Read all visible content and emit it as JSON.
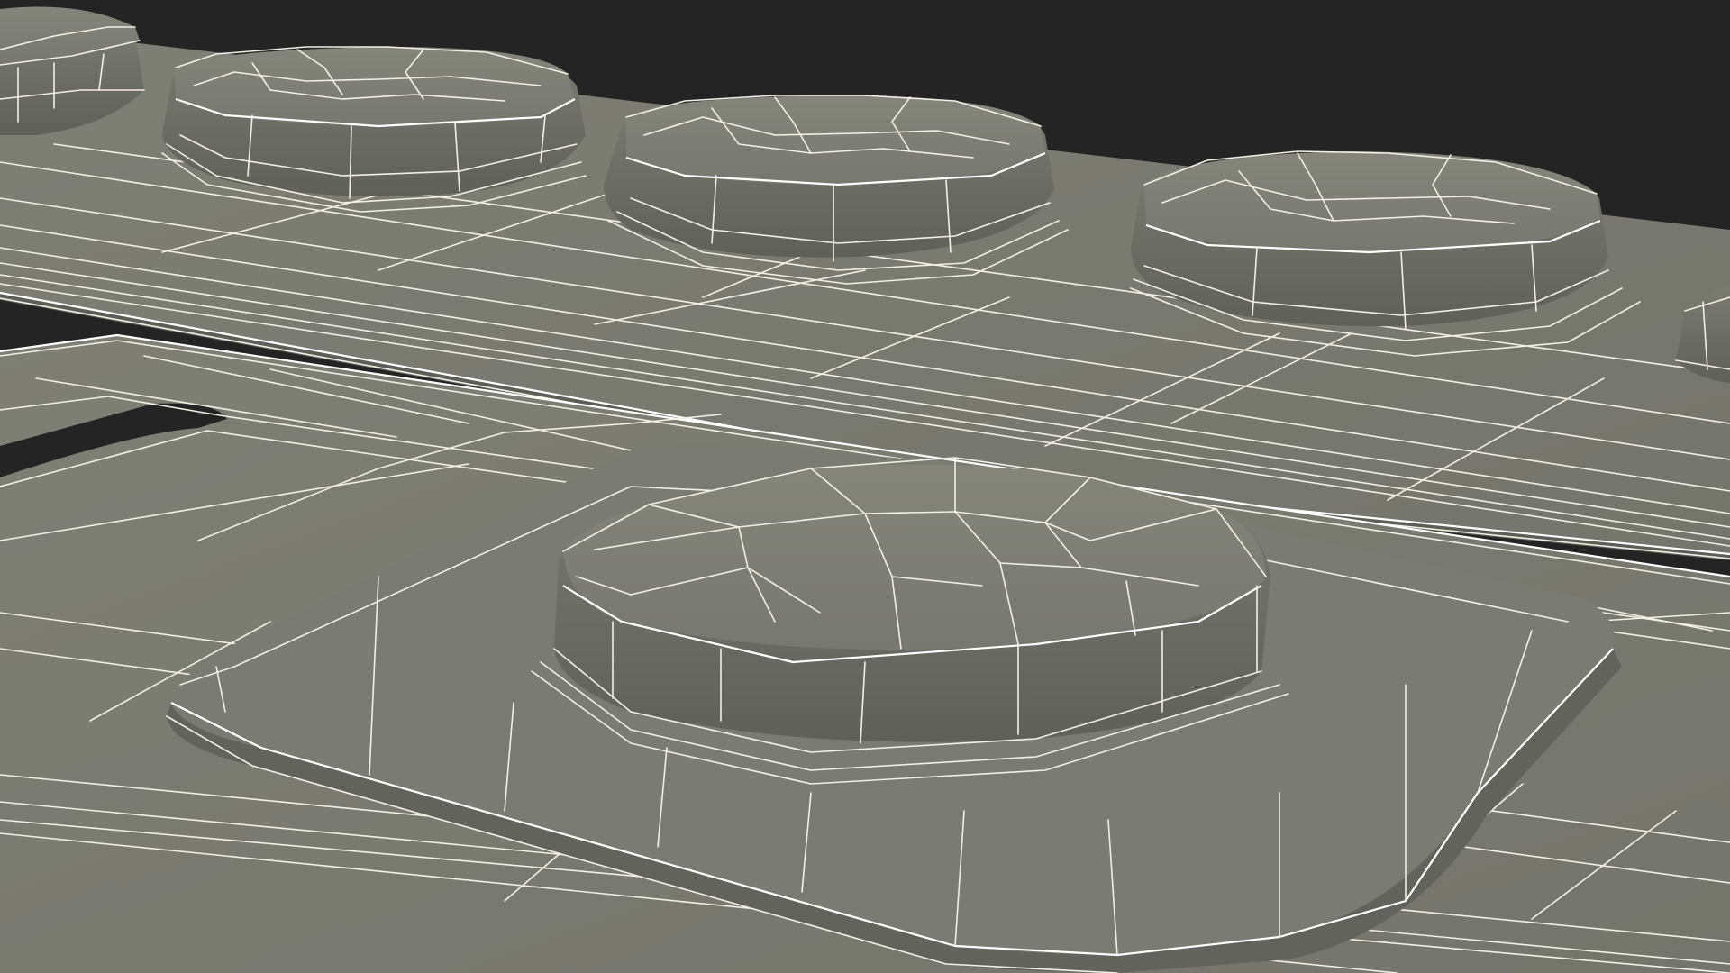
{
  "scene": {
    "background_color": "#242424",
    "surface_color": "#7b7c72",
    "surface_shadow_color": "#6a6b62",
    "wire_color": "#f2f0e6",
    "render_style": "wireframe-over-shaded"
  },
  "objects": [
    {
      "name": "upper-plate-strip",
      "bumps": 4
    },
    {
      "name": "lower-plate",
      "bumps": 1
    }
  ]
}
